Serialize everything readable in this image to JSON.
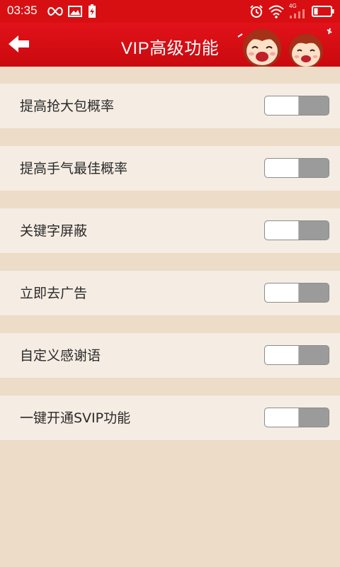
{
  "status_bar": {
    "time": "03:35",
    "network": "4G",
    "icons": [
      "infinity-icon",
      "image-icon",
      "battery-bolt-icon",
      "alarm-icon",
      "wifi-icon",
      "signal-icon",
      "battery-icon"
    ]
  },
  "header": {
    "title": "VIP高级功能",
    "back_icon": "back-arrow-icon",
    "background_color": "#d80f12"
  },
  "settings": {
    "items": [
      {
        "label": "提高抢大包概率",
        "enabled": false
      },
      {
        "label": "提高手气最佳概率",
        "enabled": false
      },
      {
        "label": "关键字屏蔽",
        "enabled": false
      },
      {
        "label": "立即去广告",
        "enabled": false
      },
      {
        "label": "自定义感谢语",
        "enabled": false
      },
      {
        "label": "一键开通SVIP功能",
        "enabled": false
      }
    ]
  },
  "colors": {
    "accent": "#d80f12",
    "page_background": "#ecdcc8",
    "row_background": "#f5ece3",
    "toggle_off": "#9b9b9b"
  }
}
